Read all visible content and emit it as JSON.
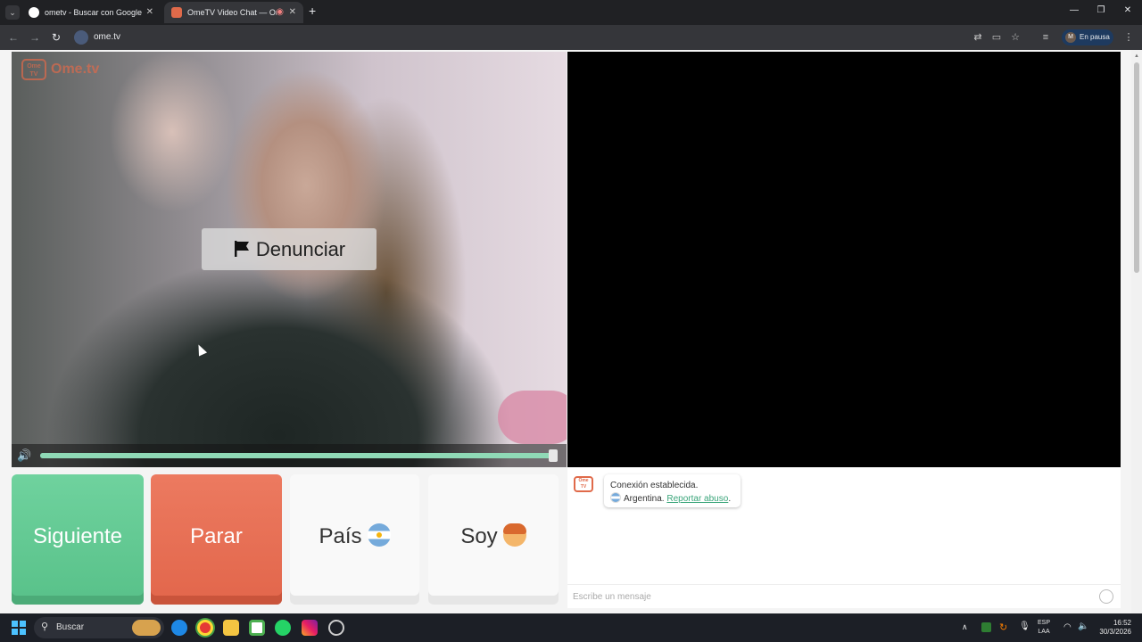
{
  "browser": {
    "tabs": [
      {
        "title": "ometv - Buscar con Google",
        "active": false
      },
      {
        "title": "OmeTV Video Chat — Ome",
        "active": true
      }
    ],
    "url": "ome.tv",
    "profile_initial": "M",
    "profile_status": "En pausa"
  },
  "site": {
    "logo_badge": "Ome TV",
    "logo_text": "Ome.tv"
  },
  "video": {
    "report_label": "Denunciar",
    "volume_percent": 100
  },
  "controls": {
    "next_label": "Siguiente",
    "stop_label": "Parar",
    "country_label": "País",
    "gender_label": "Soy"
  },
  "chat": {
    "logo_badge": "Ome TV",
    "status_line": "Conexión establecida.",
    "country": "Argentina.",
    "report_link": "Reportar abuso",
    "report_suffix": ".",
    "input_placeholder": "Escribe un mensaje"
  },
  "taskbar": {
    "search_label": "Buscar",
    "lang_top": "ESP",
    "lang_bottom": "LAA",
    "time": "16:52",
    "date": "30/3/2026"
  },
  "colors": {
    "next": "#5fc892",
    "stop": "#e6694e",
    "accent_link": "#3aa57a",
    "brand": "#e06a4a"
  }
}
